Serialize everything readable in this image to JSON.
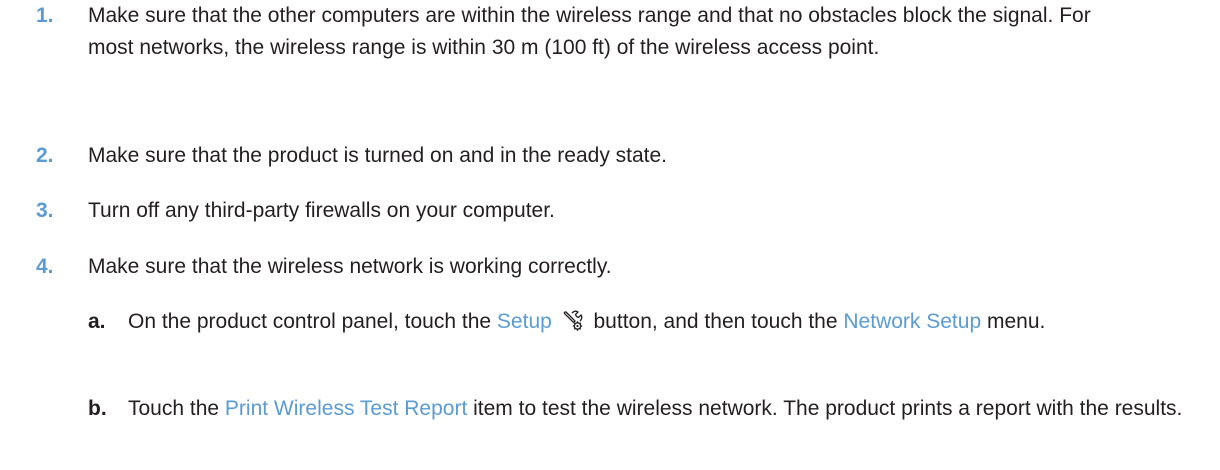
{
  "steps": [
    {
      "number": "1.",
      "text": "Make sure that the other computers are within the wireless range and that no obstacles block the signal. For most networks, the wireless range is within 30 m (100 ft) of the wireless access point."
    },
    {
      "number": "2.",
      "text": "Make sure that the product is turned on and in the ready state."
    },
    {
      "number": "3.",
      "text": "Turn off any third-party firewalls on your computer."
    },
    {
      "number": "4.",
      "text": "Make sure that the wireless network is working correctly."
    }
  ],
  "substeps": [
    {
      "letter": "a.",
      "part1": "On the product control panel, touch the",
      "ui1": "Setup",
      "icon": "setup-wrench-gear-icon",
      "part2": "button, and then touch the",
      "ui2": "Network Setup",
      "part3": "menu."
    },
    {
      "letter": "b.",
      "part1": "Touch the",
      "ui1": "Print Wireless Test Report",
      "part2": "item to test the wireless network. The product prints a report with the results."
    }
  ],
  "colors": {
    "accent": "#5b9bd5",
    "text": "#231f20"
  }
}
